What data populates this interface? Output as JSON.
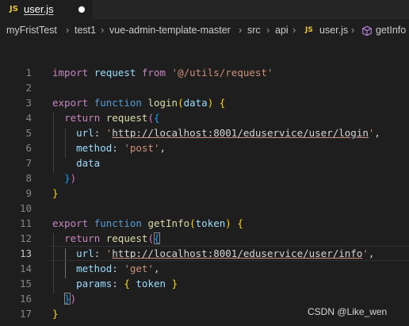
{
  "tab": {
    "badge": "JS",
    "title": "user.js"
  },
  "breadcrumb": {
    "items": [
      "myFristTest",
      "test1",
      "vue-admin-template-master",
      "src",
      "api"
    ],
    "file_badge": "JS",
    "file": "user.js",
    "symbol": "getInfo"
  },
  "lines": [
    {
      "number": "1",
      "tokens": [
        [
          "kw",
          "import"
        ],
        [
          "pn",
          " "
        ],
        [
          "vr",
          "request"
        ],
        [
          "pn",
          " "
        ],
        [
          "kw",
          "from"
        ],
        [
          "pn",
          " "
        ],
        [
          "st",
          "'@/utils/request'"
        ]
      ]
    },
    {
      "number": "2",
      "tokens": []
    },
    {
      "number": "3",
      "tokens": [
        [
          "kw",
          "export"
        ],
        [
          "pn",
          " "
        ],
        [
          "kb",
          "function"
        ],
        [
          "pn",
          " "
        ],
        [
          "fn",
          "login"
        ],
        [
          "b1",
          "("
        ],
        [
          "vr",
          "data"
        ],
        [
          "b1",
          ")"
        ],
        [
          "pn",
          " "
        ],
        [
          "b1",
          "{"
        ]
      ]
    },
    {
      "number": "4",
      "tokens": [
        [
          "pn",
          "  "
        ],
        [
          "kw",
          "return"
        ],
        [
          "pn",
          " "
        ],
        [
          "fn",
          "request"
        ],
        [
          "b2",
          "("
        ],
        [
          "b3",
          "{"
        ]
      ]
    },
    {
      "number": "5",
      "tokens": [
        [
          "pn",
          "    "
        ],
        [
          "vr",
          "url"
        ],
        [
          "pn",
          ": "
        ],
        [
          "st",
          "'"
        ],
        [
          "lk",
          "http://localhost:8001/eduservice/user/login"
        ],
        [
          "st",
          "'"
        ],
        [
          "pn",
          ","
        ]
      ]
    },
    {
      "number": "6",
      "tokens": [
        [
          "pn",
          "    "
        ],
        [
          "vr",
          "method"
        ],
        [
          "pn",
          ": "
        ],
        [
          "st",
          "'post'"
        ],
        [
          "pn",
          ","
        ]
      ]
    },
    {
      "number": "7",
      "tokens": [
        [
          "pn",
          "    "
        ],
        [
          "vr",
          "data"
        ]
      ]
    },
    {
      "number": "8",
      "tokens": [
        [
          "pn",
          "  "
        ],
        [
          "b3",
          "}"
        ],
        [
          "b2",
          ")"
        ]
      ]
    },
    {
      "number": "9",
      "tokens": [
        [
          "b1",
          "}"
        ]
      ]
    },
    {
      "number": "10",
      "tokens": []
    },
    {
      "number": "11",
      "tokens": [
        [
          "kw",
          "export"
        ],
        [
          "pn",
          " "
        ],
        [
          "kb",
          "function"
        ],
        [
          "pn",
          " "
        ],
        [
          "fn",
          "getInfo"
        ],
        [
          "b1",
          "("
        ],
        [
          "vr",
          "token"
        ],
        [
          "b1",
          ")"
        ],
        [
          "pn",
          " "
        ],
        [
          "b1",
          "{"
        ]
      ]
    },
    {
      "number": "12",
      "tokens": [
        [
          "pn",
          "  "
        ],
        [
          "kw",
          "return"
        ],
        [
          "pn",
          " "
        ],
        [
          "fn",
          "request"
        ],
        [
          "b2",
          "("
        ],
        [
          "b3 box",
          "{"
        ]
      ]
    },
    {
      "number": "13",
      "tokens": [
        [
          "pn",
          "    "
        ],
        [
          "vr",
          "url"
        ],
        [
          "pn",
          ": "
        ],
        [
          "st",
          "'"
        ],
        [
          "lk",
          "http://localhost:8001/eduservice/user/info"
        ],
        [
          "st",
          "'"
        ],
        [
          "pn",
          ","
        ]
      ]
    },
    {
      "number": "14",
      "tokens": [
        [
          "pn",
          "    "
        ],
        [
          "vr",
          "method"
        ],
        [
          "pn",
          ": "
        ],
        [
          "st",
          "'get'"
        ],
        [
          "pn",
          ","
        ]
      ]
    },
    {
      "number": "15",
      "tokens": [
        [
          "pn",
          "    "
        ],
        [
          "vr",
          "params"
        ],
        [
          "pn",
          ": "
        ],
        [
          "b1",
          "{"
        ],
        [
          "pn",
          " "
        ],
        [
          "vr",
          "token"
        ],
        [
          "pn",
          " "
        ],
        [
          "b1",
          "}"
        ]
      ]
    },
    {
      "number": "16",
      "tokens": [
        [
          "pn",
          "  "
        ],
        [
          "b3 box",
          "}"
        ],
        [
          "b2",
          ")"
        ]
      ]
    },
    {
      "number": "17",
      "tokens": [
        [
          "b1",
          "}"
        ]
      ]
    }
  ],
  "active_line": "13",
  "watermark": "CSDN @Like_wen",
  "colors": {
    "background": "#1e1e1e",
    "keyword_control": "#c586c0",
    "keyword": "#569cd6",
    "function": "#dcdcaa",
    "variable": "#9cdcfe",
    "string": "#ce9178",
    "bracket_1": "#ffd700",
    "bracket_2": "#da70d6",
    "bracket_3": "#179fff"
  }
}
